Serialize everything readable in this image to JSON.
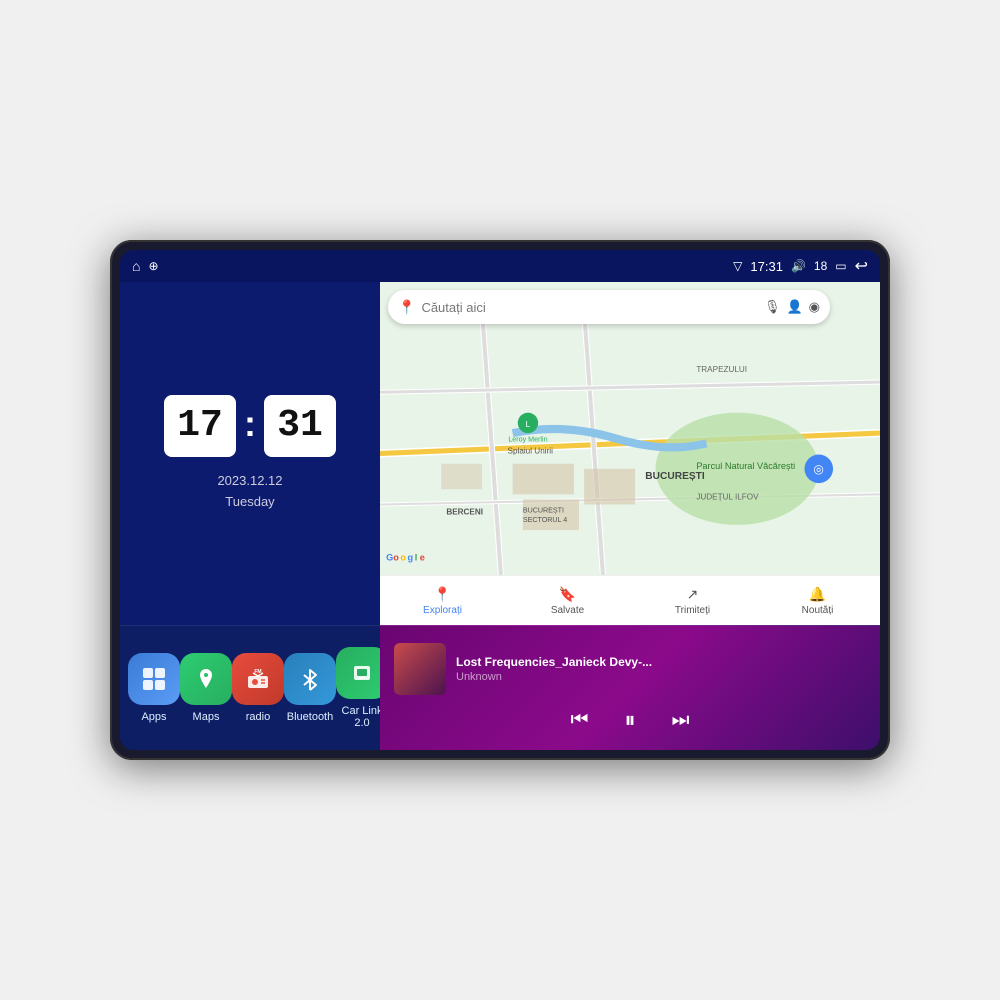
{
  "device": {
    "screen_bg": "#0d1b6e"
  },
  "status_bar": {
    "time": "17:31",
    "signal": "18",
    "home_icon": "⌂",
    "location_icon": "⊕",
    "signal_icon": "▽",
    "volume_icon": "🔊",
    "battery_icon": "▭",
    "back_icon": "↩"
  },
  "clock": {
    "hours": "17",
    "minutes": "31",
    "date": "2023.12.12",
    "day": "Tuesday"
  },
  "apps": [
    {
      "id": "apps",
      "label": "Apps",
      "icon": "⊞",
      "class": "icon-apps"
    },
    {
      "id": "maps",
      "label": "Maps",
      "icon": "📍",
      "class": "icon-maps"
    },
    {
      "id": "radio",
      "label": "radio",
      "icon": "📻",
      "class": "icon-radio"
    },
    {
      "id": "bluetooth",
      "label": "Bluetooth",
      "icon": "✦",
      "class": "icon-bluetooth"
    },
    {
      "id": "carlink",
      "label": "Car Link 2.0",
      "icon": "📱",
      "class": "icon-carlink"
    }
  ],
  "map": {
    "search_placeholder": "Căutați aici",
    "nav_items": [
      {
        "id": "explore",
        "label": "Explorați",
        "icon": "📍",
        "active": true
      },
      {
        "id": "saved",
        "label": "Salvate",
        "icon": "🔖",
        "active": false
      },
      {
        "id": "share",
        "label": "Trimiteți",
        "icon": "↗",
        "active": false
      },
      {
        "id": "news",
        "label": "Noutăți",
        "icon": "🔔",
        "active": false
      }
    ],
    "labels": {
      "trapezului": "TRAPEZULUI",
      "bucuresti": "BUCUREȘTI",
      "ilfov": "JUDEȚUL ILFOV",
      "berceni": "BERCENI",
      "parcul": "Parcul Natural Văcărești",
      "leroy": "Leroy Merlin",
      "sector4": "BUCUREȘTI SECTORUL 4",
      "splaiul": "Splaiul Unirii"
    }
  },
  "music": {
    "title": "Lost Frequencies_Janieck Devy-...",
    "artist": "Unknown",
    "prev_icon": "⏮",
    "play_icon": "⏸",
    "next_icon": "⏭"
  }
}
